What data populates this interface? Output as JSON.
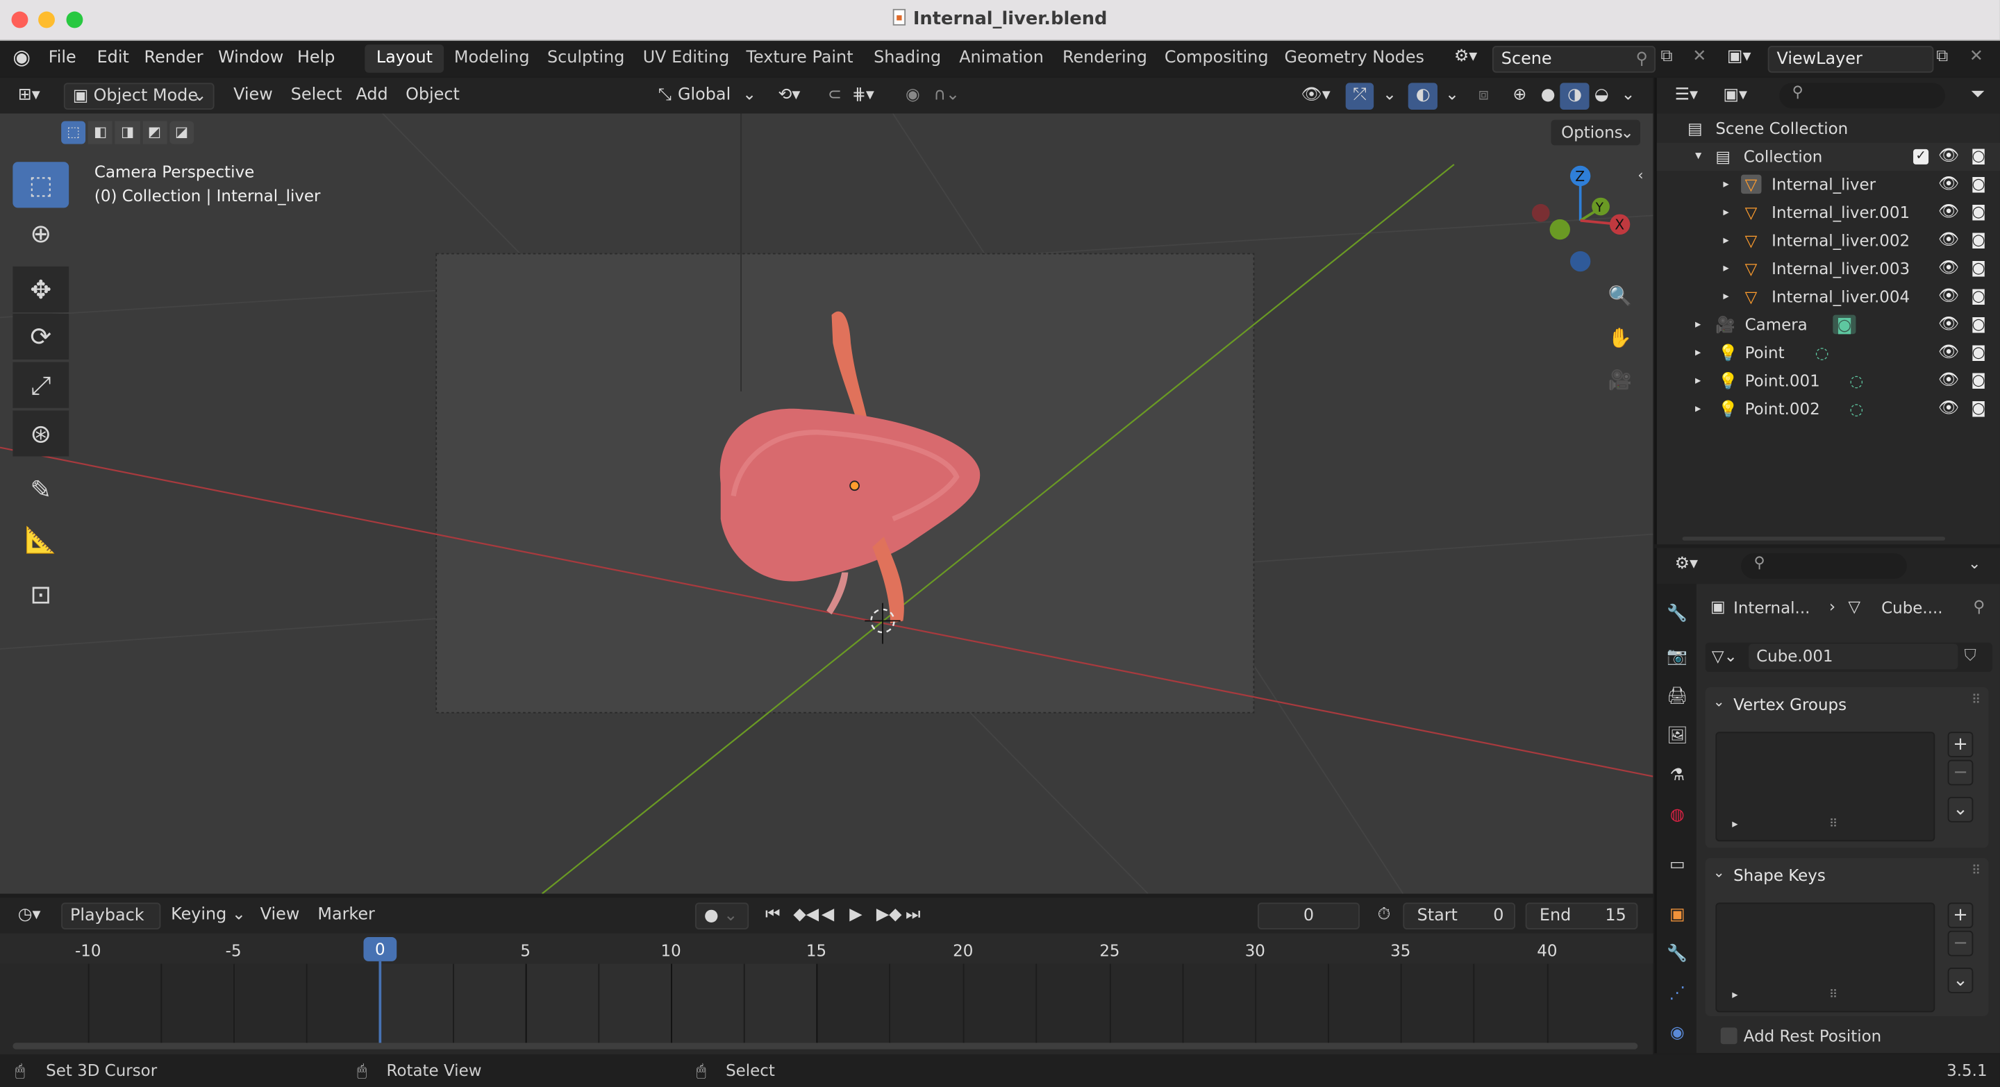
{
  "window": {
    "title": "Internal_liver.blend"
  },
  "menu": [
    "File",
    "Edit",
    "Render",
    "Window",
    "Help"
  ],
  "workspaces": [
    "Layout",
    "Modeling",
    "Sculpting",
    "UV Editing",
    "Texture Paint",
    "Shading",
    "Animation",
    "Rendering",
    "Compositing",
    "Geometry Nodes"
  ],
  "active_workspace": "Layout",
  "scene": {
    "label": "Scene"
  },
  "view_layer": {
    "label": "ViewLayer"
  },
  "viewport_header": {
    "mode": "Object Mode",
    "menus": [
      "View",
      "Select",
      "Add",
      "Object"
    ],
    "transform_orientation": "Global",
    "options_label": "Options"
  },
  "viewport": {
    "perspective_label": "Camera Perspective",
    "collection_label": "(0) Collection | Internal_liver",
    "axis_labels": {
      "z": "Z",
      "y": "Y",
      "x": "X"
    }
  },
  "outliner": {
    "root": "Scene Collection",
    "collection": "Collection",
    "items": [
      {
        "name": "Internal_liver",
        "type": "mesh"
      },
      {
        "name": "Internal_liver.001",
        "type": "mesh"
      },
      {
        "name": "Internal_liver.002",
        "type": "mesh"
      },
      {
        "name": "Internal_liver.003",
        "type": "mesh"
      },
      {
        "name": "Internal_liver.004",
        "type": "mesh"
      },
      {
        "name": "Camera",
        "type": "camera"
      },
      {
        "name": "Point",
        "type": "light"
      },
      {
        "name": "Point.001",
        "type": "light"
      },
      {
        "name": "Point.002",
        "type": "light"
      }
    ]
  },
  "properties": {
    "breadcrumb_object": "Internal...",
    "breadcrumb_data": "Cube....",
    "mesh_name": "Cube.001",
    "panels": {
      "vertex_groups": "Vertex Groups",
      "shape_keys": "Shape Keys"
    },
    "add_rest_position": "Add Rest Position"
  },
  "timeline": {
    "menus": [
      "Playback",
      "Keying",
      "View",
      "Marker"
    ],
    "current_frame": "0",
    "start_label": "Start",
    "start_value": "0",
    "end_label": "End",
    "end_value": "15",
    "ticks": [
      "-10",
      "-5",
      "0",
      "5",
      "10",
      "15",
      "20",
      "25",
      "30",
      "35",
      "40"
    ]
  },
  "statusbar": {
    "items": [
      "Set 3D Cursor",
      "Rotate View",
      "Select"
    ],
    "version": "3.5.1"
  },
  "colors": {
    "accent": "#4772b3",
    "x_axis": "#c0393f",
    "y_axis": "#6a9a24",
    "z_axis": "#2f7fd8",
    "selected_orange": "#ff9d2e"
  }
}
